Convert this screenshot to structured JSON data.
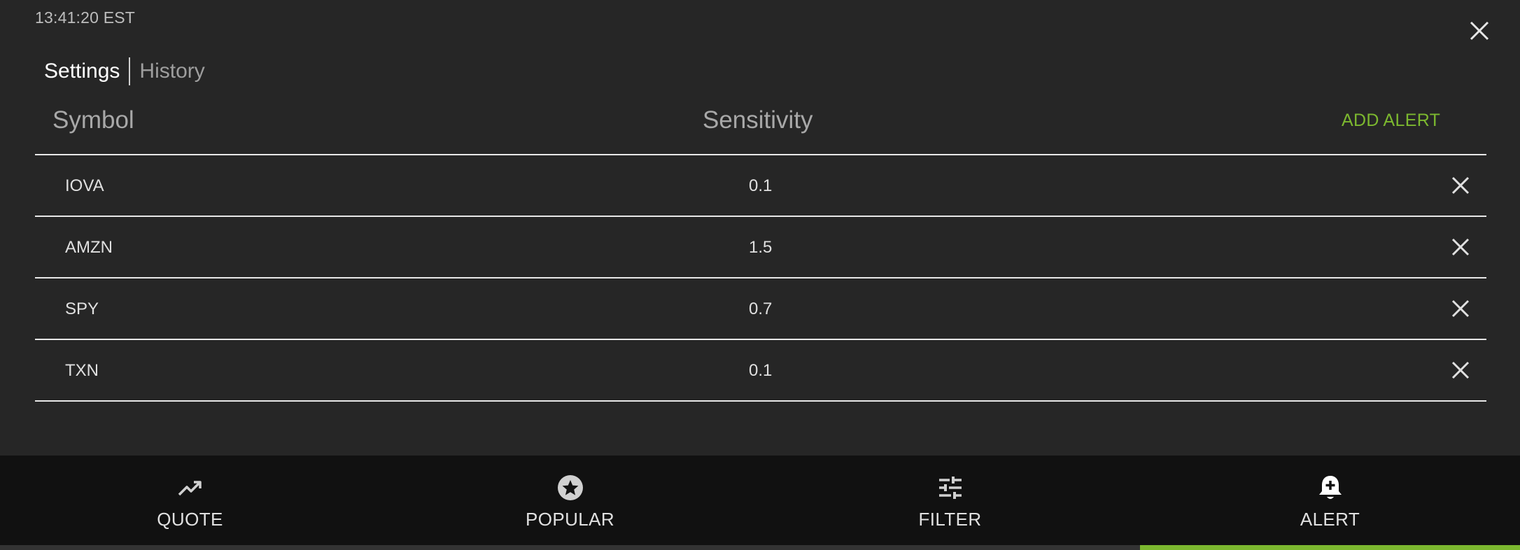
{
  "clock": "13:41:20 EST",
  "tabs": [
    {
      "label": "Settings",
      "active": true
    },
    {
      "label": "History",
      "active": false
    }
  ],
  "table": {
    "headers": {
      "symbol": "Symbol",
      "sensitivity": "Sensitivity"
    },
    "add_alert_label": "ADD ALERT",
    "rows": [
      {
        "symbol": "IOVA",
        "sensitivity": "0.1"
      },
      {
        "symbol": "AMZN",
        "sensitivity": "1.5"
      },
      {
        "symbol": "SPY",
        "sensitivity": "0.7"
      },
      {
        "symbol": "TXN",
        "sensitivity": "0.1"
      }
    ]
  },
  "bottom_nav": [
    {
      "label": "QUOTE",
      "icon": "trending-up-icon",
      "active": false
    },
    {
      "label": "POPULAR",
      "icon": "star-circle-icon",
      "active": false
    },
    {
      "label": "FILTER",
      "icon": "sliders-icon",
      "active": false
    },
    {
      "label": "ALERT",
      "icon": "bell-plus-icon",
      "active": true
    }
  ],
  "colors": {
    "background": "#262626",
    "nav_background": "#111111",
    "accent": "#7cb82f",
    "divider": "#e8e8e8"
  }
}
